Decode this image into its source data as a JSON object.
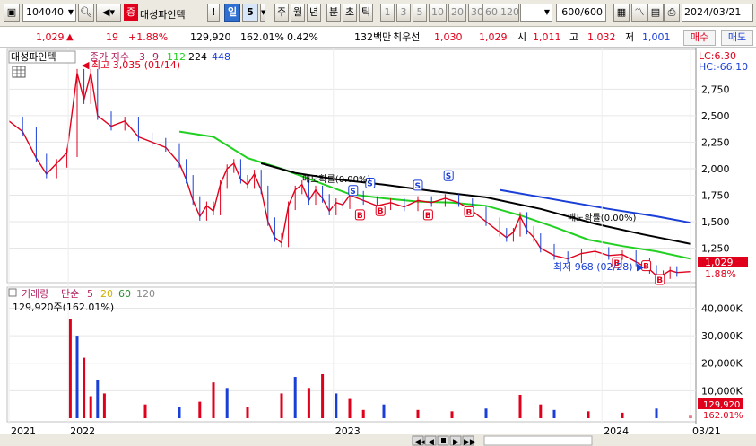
{
  "toolbar": {
    "stock_code": "104040",
    "badge": "증",
    "stock_name": "대성파인텍",
    "period_day": "일",
    "period_num": "5",
    "week": "주",
    "month": "월",
    "year": "년",
    "minute": "분",
    "second": "초",
    "tick": "틱",
    "intervals": [
      "1",
      "3",
      "5",
      "10",
      "20",
      "30",
      "60",
      "120"
    ],
    "count": "600",
    "count_total": "/600",
    "date": "2024/03/21"
  },
  "quote": {
    "price": "1,029",
    "arrow": "▲",
    "change": "19",
    "change_pct": "+1.88%",
    "volume": "129,920",
    "volume_ratio": "162.01%",
    "turnover": "0.42%",
    "value": "132백만",
    "best_ask_label": "최우선",
    "best_ask": "1,030",
    "best_bid": "1,029",
    "open_label": "시",
    "open": "1,011",
    "high_label": "고",
    "high": "1,032",
    "low_label": "저",
    "low": "1,001",
    "buy_label": "매수",
    "sell_label": "매도"
  },
  "legend": {
    "name": "대성파인텍",
    "indicator": "종가 지수",
    "ma1": "3",
    "ma2": "9",
    "ma3": "112",
    "ma4": "224",
    "ma5": "448",
    "lc": "LC:6.30",
    "hc": "HC:-66.10",
    "high_marker": "최고 3,035 (01/14)",
    "low_marker": "최저 968 (02/28)",
    "cancel1": "매도확률(0.00%)",
    "cancel2": "매도확률(0.00%)",
    "price_tag": "1,029",
    "pct_tag": "1.88%"
  },
  "volume_legend": {
    "title": "거래량",
    "type": "단순",
    "ma1": "5",
    "ma2": "20",
    "ma3": "60",
    "ma4": "120",
    "current": "129,920주(162.01%)",
    "vol_tag": "129,920",
    "vol_pct_tag": "162.01%"
  },
  "colors": {
    "candle_up": "#e0001b",
    "candle_down": "#1a3fd6",
    "ma_green": "#22d022",
    "ma_black": "#000000",
    "ma_blue": "#1a3fd6",
    "ma_yellow": "#d0b000"
  },
  "chart_data": {
    "type": "line",
    "price_axis": {
      "ylim": [
        950,
        3100
      ],
      "ticks": [
        "2,750",
        "2,500",
        "2,250",
        "2,000",
        "1,750",
        "1,500",
        "1,250"
      ]
    },
    "volume_axis": {
      "ylim": [
        0,
        47000
      ],
      "ticks": [
        "40,000K",
        "30,000K",
        "20,000K",
        "10,000K"
      ]
    },
    "x_labels": [
      {
        "label": "2021",
        "t": 0.0
      },
      {
        "label": "2022",
        "t": 0.087
      },
      {
        "label": "2023",
        "t": 0.476
      },
      {
        "label": "2024",
        "t": 0.87
      },
      {
        "label": "03/21",
        "t": 1.0
      }
    ],
    "price_series": [
      [
        0.0,
        2450
      ],
      [
        0.02,
        2350
      ],
      [
        0.04,
        2100
      ],
      [
        0.055,
        1950
      ],
      [
        0.07,
        2050
      ],
      [
        0.085,
        2150
      ],
      [
        0.1,
        2900
      ],
      [
        0.11,
        2650
      ],
      [
        0.12,
        2900
      ],
      [
        0.13,
        2500
      ],
      [
        0.15,
        2400
      ],
      [
        0.17,
        2450
      ],
      [
        0.19,
        2300
      ],
      [
        0.21,
        2250
      ],
      [
        0.23,
        2200
      ],
      [
        0.25,
        2050
      ],
      [
        0.26,
        1900
      ],
      [
        0.27,
        1700
      ],
      [
        0.28,
        1550
      ],
      [
        0.29,
        1650
      ],
      [
        0.3,
        1600
      ],
      [
        0.31,
        1850
      ],
      [
        0.32,
        2000
      ],
      [
        0.33,
        2050
      ],
      [
        0.34,
        1900
      ],
      [
        0.35,
        1850
      ],
      [
        0.36,
        1950
      ],
      [
        0.37,
        1800
      ],
      [
        0.38,
        1500
      ],
      [
        0.39,
        1350
      ],
      [
        0.4,
        1300
      ],
      [
        0.41,
        1650
      ],
      [
        0.42,
        1800
      ],
      [
        0.43,
        1850
      ],
      [
        0.44,
        1700
      ],
      [
        0.45,
        1800
      ],
      [
        0.46,
        1720
      ],
      [
        0.47,
        1600
      ],
      [
        0.48,
        1680
      ],
      [
        0.49,
        1660
      ],
      [
        0.5,
        1750
      ],
      [
        0.52,
        1700
      ],
      [
        0.54,
        1650
      ],
      [
        0.56,
        1680
      ],
      [
        0.58,
        1640
      ],
      [
        0.6,
        1700
      ],
      [
        0.62,
        1680
      ],
      [
        0.64,
        1720
      ],
      [
        0.66,
        1680
      ],
      [
        0.68,
        1600
      ],
      [
        0.7,
        1500
      ],
      [
        0.72,
        1400
      ],
      [
        0.73,
        1350
      ],
      [
        0.74,
        1400
      ],
      [
        0.75,
        1550
      ],
      [
        0.76,
        1420
      ],
      [
        0.77,
        1350
      ],
      [
        0.78,
        1250
      ],
      [
        0.8,
        1180
      ],
      [
        0.82,
        1150
      ],
      [
        0.84,
        1200
      ],
      [
        0.86,
        1220
      ],
      [
        0.88,
        1180
      ],
      [
        0.9,
        1190
      ],
      [
        0.92,
        1120
      ],
      [
        0.94,
        1050
      ],
      [
        0.95,
        990
      ],
      [
        0.96,
        1000
      ],
      [
        0.97,
        1040
      ],
      [
        0.98,
        1020
      ],
      [
        1.0,
        1029
      ]
    ],
    "series": [
      {
        "name": "112",
        "color": "#22d022",
        "points": [
          [
            0.25,
            2350
          ],
          [
            0.3,
            2300
          ],
          [
            0.35,
            2100
          ],
          [
            0.4,
            2000
          ],
          [
            0.45,
            1880
          ],
          [
            0.5,
            1760
          ],
          [
            0.55,
            1720
          ],
          [
            0.6,
            1690
          ],
          [
            0.65,
            1680
          ],
          [
            0.7,
            1650
          ],
          [
            0.75,
            1560
          ],
          [
            0.8,
            1450
          ],
          [
            0.85,
            1330
          ],
          [
            0.9,
            1270
          ],
          [
            0.95,
            1220
          ],
          [
            1.0,
            1150
          ]
        ]
      },
      {
        "name": "224",
        "color": "#000000",
        "points": [
          [
            0.37,
            2050
          ],
          [
            0.42,
            1960
          ],
          [
            0.48,
            1900
          ],
          [
            0.55,
            1850
          ],
          [
            0.62,
            1790
          ],
          [
            0.7,
            1730
          ],
          [
            0.78,
            1620
          ],
          [
            0.86,
            1480
          ],
          [
            0.93,
            1380
          ],
          [
            1.0,
            1290
          ]
        ]
      },
      {
        "name": "448",
        "color": "#1a3fd6",
        "points": [
          [
            0.72,
            1800
          ],
          [
            0.8,
            1710
          ],
          [
            0.88,
            1620
          ],
          [
            0.95,
            1550
          ],
          [
            1.0,
            1490
          ]
        ]
      }
    ],
    "volume_spikes": [
      [
        0.09,
        36000
      ],
      [
        0.1,
        30000
      ],
      [
        0.11,
        22000
      ],
      [
        0.12,
        8000
      ],
      [
        0.13,
        14000
      ],
      [
        0.14,
        9000
      ],
      [
        0.2,
        5000
      ],
      [
        0.25,
        4000
      ],
      [
        0.28,
        6000
      ],
      [
        0.3,
        13000
      ],
      [
        0.32,
        11000
      ],
      [
        0.35,
        4000
      ],
      [
        0.4,
        9000
      ],
      [
        0.42,
        15000
      ],
      [
        0.44,
        11000
      ],
      [
        0.46,
        16000
      ],
      [
        0.48,
        9000
      ],
      [
        0.5,
        7000
      ],
      [
        0.52,
        3000
      ],
      [
        0.55,
        5000
      ],
      [
        0.6,
        3000
      ],
      [
        0.65,
        2500
      ],
      [
        0.7,
        3500
      ],
      [
        0.75,
        8500
      ],
      [
        0.78,
        5000
      ],
      [
        0.8,
        3000
      ],
      [
        0.85,
        2500
      ],
      [
        0.9,
        2000
      ],
      [
        0.95,
        3500
      ],
      [
        1.0,
        900
      ]
    ],
    "signals": [
      {
        "t": 0.505,
        "p": 1790,
        "kind": "S"
      },
      {
        "t": 0.53,
        "p": 1860,
        "kind": "S"
      },
      {
        "t": 0.6,
        "p": 1840,
        "kind": "S"
      },
      {
        "t": 0.645,
        "p": 1930,
        "kind": "S"
      },
      {
        "t": 0.515,
        "p": 1560,
        "kind": "B"
      },
      {
        "t": 0.545,
        "p": 1600,
        "kind": "B"
      },
      {
        "t": 0.615,
        "p": 1560,
        "kind": "B"
      },
      {
        "t": 0.675,
        "p": 1590,
        "kind": "B"
      },
      {
        "t": 0.892,
        "p": 1110,
        "kind": "B"
      },
      {
        "t": 0.935,
        "p": 1080,
        "kind": "B"
      },
      {
        "t": 0.955,
        "p": 950,
        "kind": "B"
      }
    ]
  }
}
